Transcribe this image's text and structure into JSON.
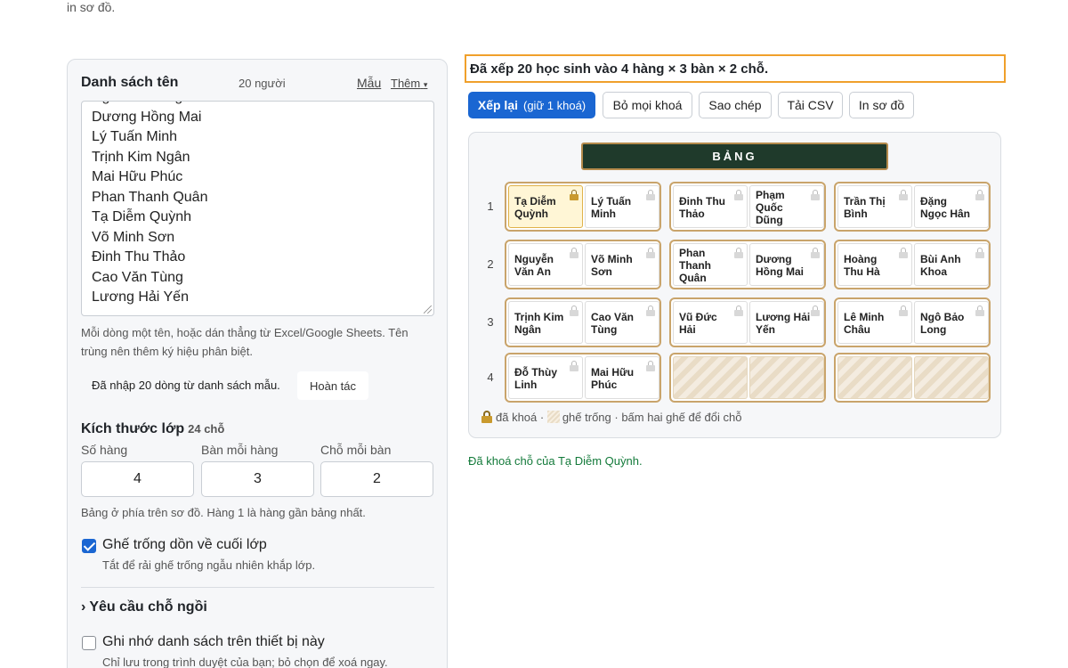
{
  "top_fragment": "in sơ đồ.",
  "names": {
    "title": "Danh sách tên",
    "count": "20 người",
    "sample_link": "Mẫu",
    "more_link": "Thêm",
    "more_caret": "▾",
    "lines": [
      "Ngô Bảo Long",
      "Dương Hồng Mai",
      "Lý Tuấn Minh",
      "Trịnh Kim Ngân",
      "Mai Hữu Phúc",
      "Phan Thanh Quân",
      "Tạ Diễm Quỳnh",
      "Võ Minh Sơn",
      "Đinh Thu Thảo",
      "Cao Văn Tùng",
      "Lương Hải Yến"
    ],
    "help": "Mỗi dòng một tên, hoặc dán thẳng từ Excel/Google Sheets. Tên trùng nên thêm ký hiệu phân biệt.",
    "import_msg": "Đã nhập 20 dòng từ danh sách mẫu.",
    "undo": "Hoàn tác"
  },
  "size": {
    "title": "Kích thước lớp",
    "capacity": "24 chỗ",
    "rows_label": "Số hàng",
    "rows_value": "4",
    "desks_label": "Bàn mỗi hàng",
    "desks_value": "3",
    "seats_label": "Chỗ mỗi bàn",
    "seats_value": "2",
    "note": "Bảng ở phía trên sơ đồ. Hàng 1 là hàng gần bảng nhất."
  },
  "options": {
    "empty_back_label": "Ghế trống dồn về cuối lớp",
    "empty_back_checked": true,
    "empty_back_sub": "Tắt để rải ghế trống ngẫu nhiên khắp lớp.",
    "requests_label": "Yêu cầu chỗ ngồi",
    "requests_chevron": "›",
    "remember_label": "Ghi nhớ danh sách trên thiết bị này",
    "remember_checked": false,
    "remember_sub": "Chỉ lưu trong trình duyệt của bạn; bỏ chọn để xoá ngay."
  },
  "status": "Đã xếp 20 học sinh vào 4 hàng × 3 bàn × 2 chỗ.",
  "toolbar": {
    "reshuffle": "Xếp lại",
    "reshuffle_sub": "(giữ 1 khoá)",
    "unlock_all": "Bỏ mọi khoá",
    "copy": "Sao chép",
    "download_csv": "Tải CSV",
    "print": "In sơ đồ"
  },
  "board_label": "BẢNG",
  "rows": [
    {
      "num": "1",
      "desks": [
        {
          "seats": [
            {
              "name": "Tạ Diễm Quỳnh",
              "locked": true
            },
            {
              "name": "Lý Tuấn Minh",
              "locked": false
            }
          ]
        },
        {
          "seats": [
            {
              "name": "Đinh Thu Thảo",
              "locked": false
            },
            {
              "name": "Phạm Quốc Dũng",
              "locked": false
            }
          ]
        },
        {
          "seats": [
            {
              "name": "Trần Thị Bình",
              "locked": false
            },
            {
              "name": "Đặng Ngọc Hân",
              "locked": false
            }
          ]
        }
      ]
    },
    {
      "num": "2",
      "desks": [
        {
          "seats": [
            {
              "name": "Nguyễn Văn An",
              "locked": false
            },
            {
              "name": "Võ Minh Sơn",
              "locked": false
            }
          ]
        },
        {
          "seats": [
            {
              "name": "Phan Thanh Quân",
              "locked": false
            },
            {
              "name": "Dương Hồng Mai",
              "locked": false
            }
          ]
        },
        {
          "seats": [
            {
              "name": "Hoàng Thu Hà",
              "locked": false
            },
            {
              "name": "Bùi Anh Khoa",
              "locked": false
            }
          ]
        }
      ]
    },
    {
      "num": "3",
      "desks": [
        {
          "seats": [
            {
              "name": "Trịnh Kim Ngân",
              "locked": false
            },
            {
              "name": "Cao Văn Tùng",
              "locked": false
            }
          ]
        },
        {
          "seats": [
            {
              "name": "Vũ Đức Hải",
              "locked": false
            },
            {
              "name": "Lương Hải Yến",
              "locked": false
            }
          ]
        },
        {
          "seats": [
            {
              "name": "Lê Minh Châu",
              "locked": false
            },
            {
              "name": "Ngô Bảo Long",
              "locked": false
            }
          ]
        }
      ]
    },
    {
      "num": "4",
      "desks": [
        {
          "seats": [
            {
              "name": "Đỗ Thùy Linh",
              "locked": false
            },
            {
              "name": "Mai Hữu Phúc",
              "locked": false
            }
          ]
        },
        {
          "seats": [
            {
              "name": "",
              "empty": true
            },
            {
              "name": "",
              "empty": true
            }
          ]
        },
        {
          "seats": [
            {
              "name": "",
              "empty": true
            },
            {
              "name": "",
              "empty": true
            }
          ]
        }
      ]
    }
  ],
  "legend": {
    "locked": "đã khoá ·",
    "empty": "ghế trống · bấm hai ghế để đổi chỗ"
  },
  "lock_message": "Đã khoá chỗ của Tạ Diễm Quỳnh."
}
